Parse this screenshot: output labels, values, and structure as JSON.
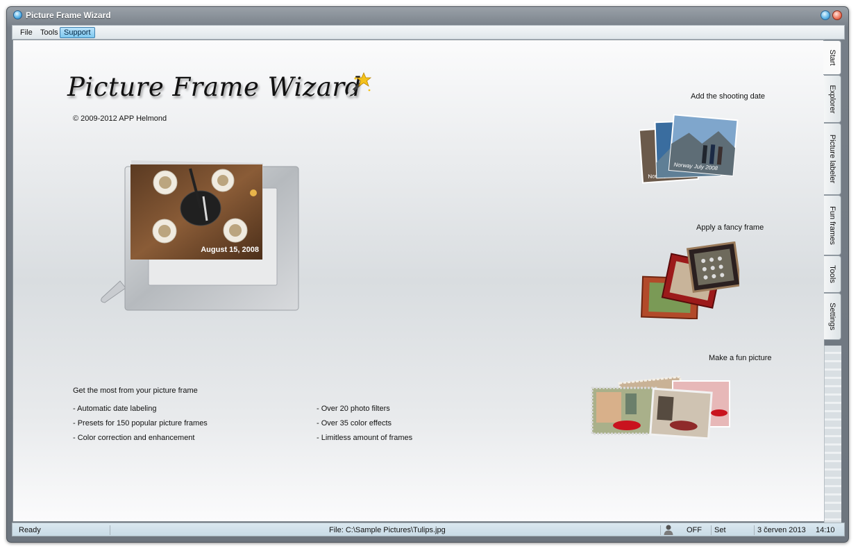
{
  "window": {
    "title": "Picture Frame Wizard"
  },
  "menu": {
    "items": [
      "File",
      "Tools",
      "Support"
    ]
  },
  "logo": {
    "text": "Picture Frame Wizard"
  },
  "copyright": "© 2009-2012 APP Helmond",
  "features": {
    "heading": "Get the most from your picture frame",
    "left": [
      "- Automatic date labeling",
      "- Presets for 150 popular picture frames",
      "- Color correction and enhancement"
    ],
    "right": [
      "- Over 20 photo filters",
      "- Over 35 color effects",
      "- Limitless amount of frames"
    ]
  },
  "frame_photo_date": "August 15, 2008",
  "promos": {
    "date": {
      "label": "Add the shooting date",
      "stamp_front": "Norway July 2008",
      "stamp_back": "Norway July 2008"
    },
    "frame": {
      "label": "Apply a fancy frame"
    },
    "fun": {
      "label": "Make a fun picture"
    }
  },
  "side_tabs": [
    "Start",
    "Explorer",
    "Picture labeler",
    "Fun frames",
    "Tools",
    "Settings"
  ],
  "status": {
    "left": "Ready",
    "file": "File: C:\\Sample Pictures\\Tulips.jpg",
    "toggle": "OFF",
    "set": "Set",
    "date": "3 červen 2013",
    "time": "14:10"
  },
  "colors": {
    "title_bar": "#7d858d",
    "menu_active": "#8ccdf0",
    "status_bar": "#d0e0ea",
    "close_button": "#e5634a",
    "minimize_button": "#56b0e3"
  }
}
